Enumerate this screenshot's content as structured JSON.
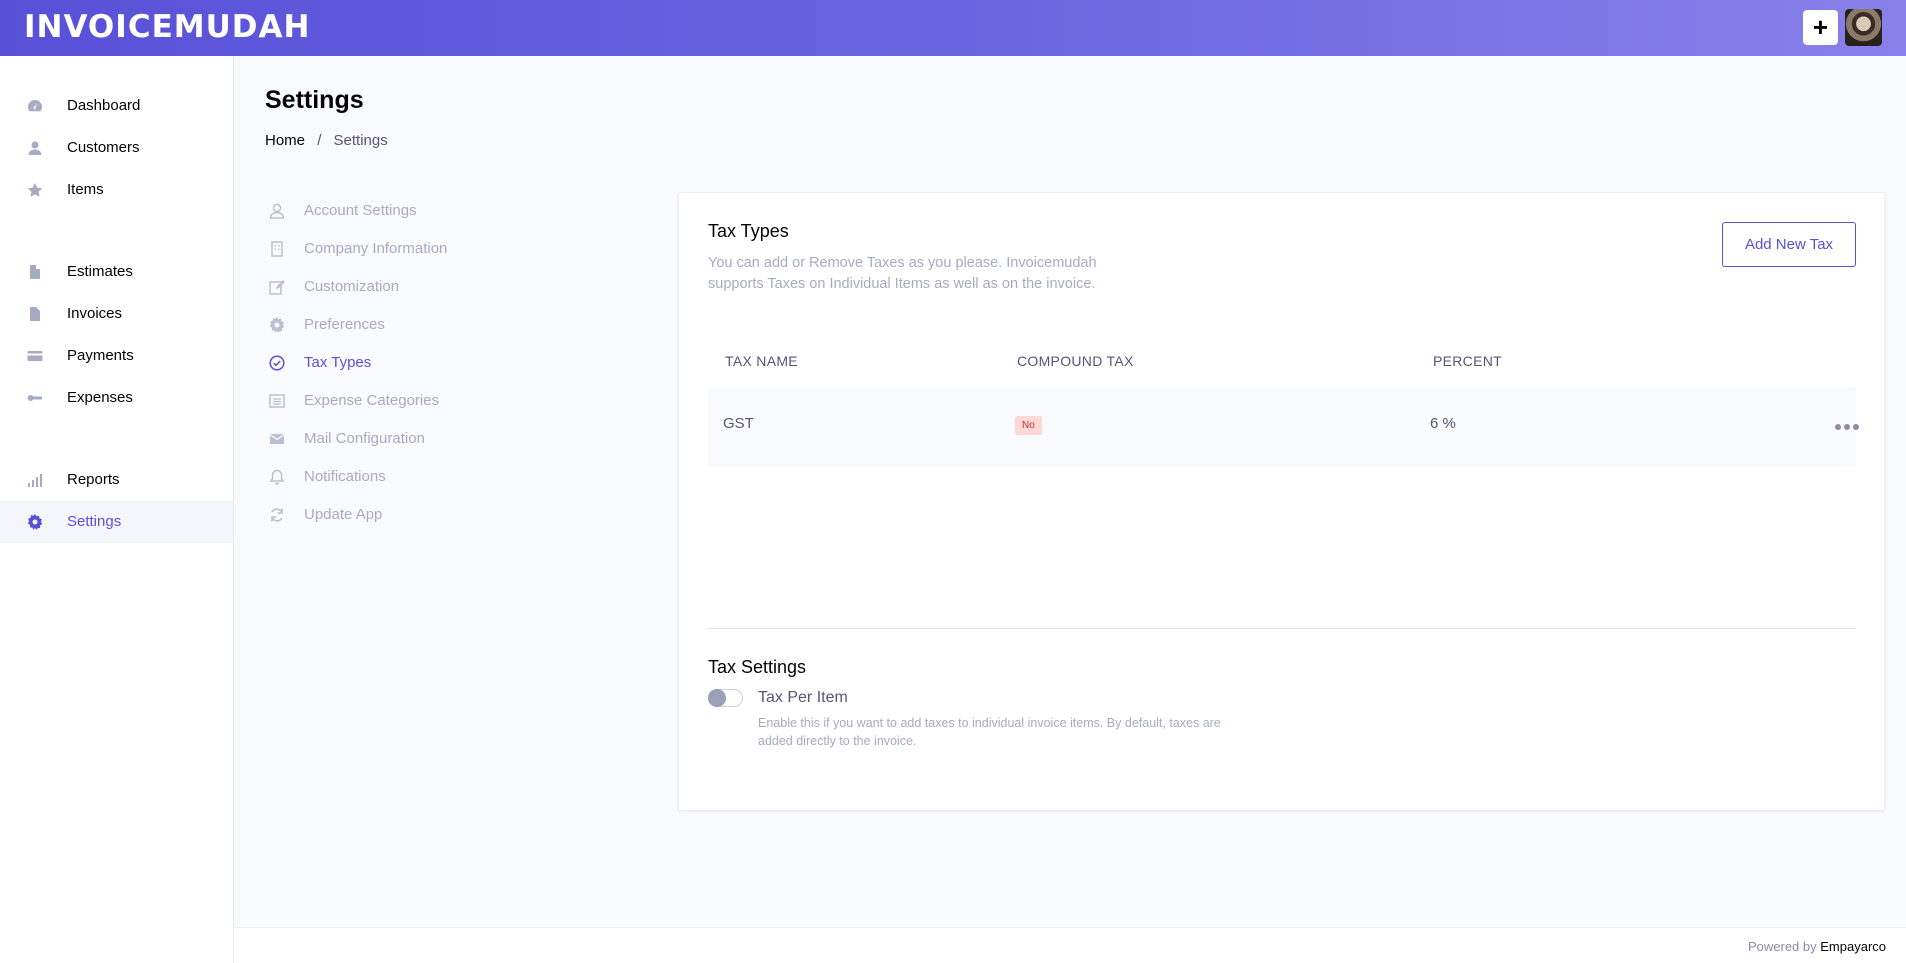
{
  "header": {
    "logo": "INVOICEMUDAH",
    "add_label": "+"
  },
  "sidebar": {
    "items": [
      {
        "label": "Dashboard",
        "icon": "dashboard-icon"
      },
      {
        "label": "Customers",
        "icon": "user-icon"
      },
      {
        "label": "Items",
        "icon": "star-icon"
      },
      {
        "label": "Estimates",
        "icon": "document-icon"
      },
      {
        "label": "Invoices",
        "icon": "document-icon"
      },
      {
        "label": "Payments",
        "icon": "credit-card-icon"
      },
      {
        "label": "Expenses",
        "icon": "key-icon"
      },
      {
        "label": "Reports",
        "icon": "bar-signal-icon"
      },
      {
        "label": "Settings",
        "icon": "gear-icon",
        "active": true
      }
    ]
  },
  "page": {
    "title": "Settings",
    "breadcrumb": {
      "home": "Home",
      "sep": "/",
      "current": "Settings"
    }
  },
  "settings_menu": {
    "items": [
      {
        "label": "Account Settings",
        "icon": "user-icon"
      },
      {
        "label": "Company Information",
        "icon": "building-icon"
      },
      {
        "label": "Customization",
        "icon": "edit-icon"
      },
      {
        "label": "Preferences",
        "icon": "gear-icon"
      },
      {
        "label": "Tax Types",
        "icon": "check-circle-icon",
        "active": true
      },
      {
        "label": "Expense Categories",
        "icon": "list-icon"
      },
      {
        "label": "Mail Configuration",
        "icon": "mail-icon"
      },
      {
        "label": "Notifications",
        "icon": "bell-icon"
      },
      {
        "label": "Update App",
        "icon": "refresh-icon"
      }
    ]
  },
  "tax_types": {
    "title": "Tax Types",
    "description": "You can add or Remove Taxes as you please. Invoicemudah supports Taxes on Individual Items as well as on the invoice.",
    "add_button": "Add New Tax",
    "columns": [
      "TAX NAME",
      "COMPOUND TAX",
      "PERCENT"
    ],
    "rows": [
      {
        "name": "GST",
        "compound": "No",
        "percent": "6 %"
      }
    ]
  },
  "tax_settings": {
    "title": "Tax Settings",
    "toggle_label": "Tax Per Item",
    "toggle_on": false,
    "description": "Enable this if you want to add taxes to individual invoice items. By default, taxes are added directly to the invoice."
  },
  "footer": {
    "prefix": "Powered by",
    "brand": "Empayarco"
  },
  "colors": {
    "primary": "#5851d8",
    "badge_bg": "#fed7d7",
    "badge_text": "#c53030"
  }
}
